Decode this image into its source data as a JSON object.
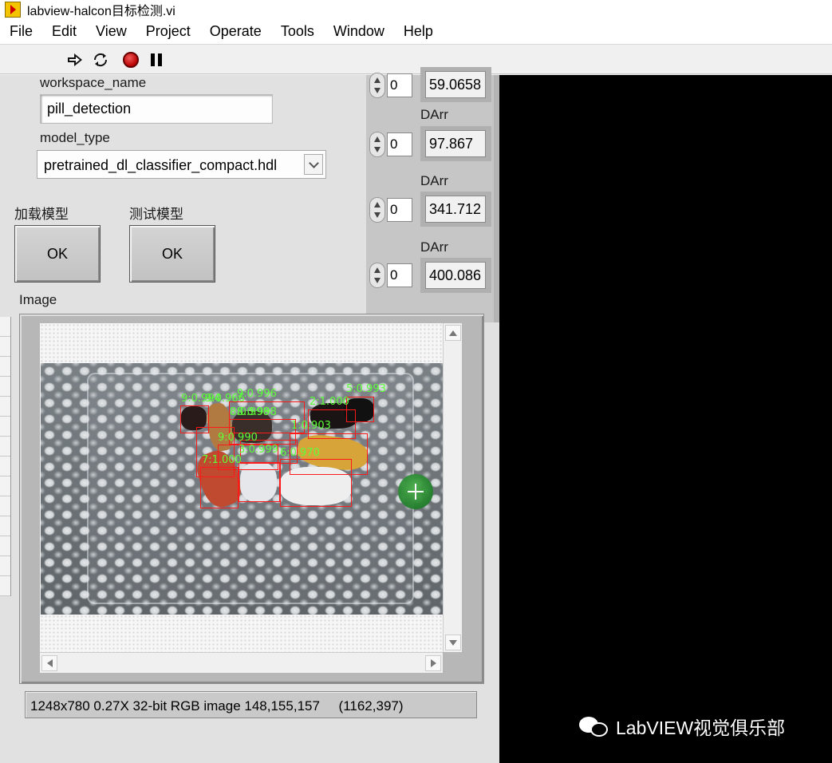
{
  "window": {
    "title": "labview-halcon目标检测.vi"
  },
  "menubar": {
    "items": [
      "File",
      "Edit",
      "View",
      "Project",
      "Operate",
      "Tools",
      "Window",
      "Help"
    ]
  },
  "toolbar": {
    "buttons": [
      "run-arrow-icon",
      "run-continuously-icon",
      "abort-icon",
      "pause-icon"
    ]
  },
  "front_panel": {
    "workspace_name": {
      "label": "workspace_name",
      "value": "pill_detection"
    },
    "model_type": {
      "label": "model_type",
      "value": "pretrained_dl_classifier_compact.hdl"
    },
    "load_model": {
      "label": "加载模型",
      "button": "OK"
    },
    "test_model": {
      "label": "测试模型",
      "button": "OK"
    },
    "image_label": "Image"
  },
  "arrays": [
    {
      "label": "",
      "index": "0",
      "value": "59.0658"
    },
    {
      "label": "DArr",
      "index": "0",
      "value": "97.867"
    },
    {
      "label": "DArr",
      "index": "0",
      "value": "341.712"
    },
    {
      "label": "DArr",
      "index": "0",
      "value": "400.086"
    }
  ],
  "detections": [
    {
      "label": "9:0.994"
    },
    {
      "label": "9:0.966"
    },
    {
      "label": "9:0.996"
    },
    {
      "label": "8:0.998"
    },
    {
      "label": "8:0.998"
    },
    {
      "label": "2:1.000"
    },
    {
      "label": "5:0.993"
    },
    {
      "label": "1:0.903"
    },
    {
      "label": "9:0.990"
    },
    {
      "label": "3:0.999"
    },
    {
      "label": "6:0.970"
    },
    {
      "label": "7:1.000"
    }
  ],
  "status_bar": {
    "text": "1248x780 0.27X 32-bit RGB image 148,155,157     (1162,397)"
  },
  "watermark": {
    "text": "LabVIEW视觉俱乐部"
  },
  "colors": {
    "detection_box": "#ff1a1a",
    "detection_label": "#5cff3a",
    "panel_bg": "#e1e1e1"
  }
}
